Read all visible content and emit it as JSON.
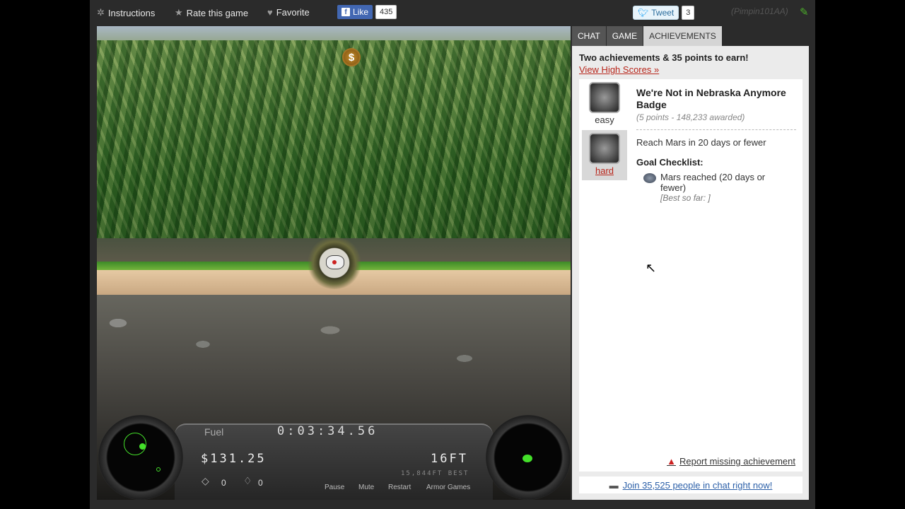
{
  "topbar": {
    "instructions": "Instructions",
    "rate": "Rate this game",
    "favorite": "Favorite",
    "fb_like": "Like",
    "fb_count": "435",
    "tweet": "Tweet",
    "tweet_count": "3",
    "username": "(Pimpin101AA)"
  },
  "game": {
    "coin_symbol": "$",
    "hud": {
      "fuel_label": "Fuel",
      "timer": "0:03:34.56",
      "money": "$131.25",
      "depth": "16FT",
      "best": "15,844FT BEST",
      "item1_count": "0",
      "item2_count": "0",
      "pause": "Pause",
      "mute": "Mute",
      "restart": "Restart",
      "armor": "Armor Games"
    },
    "radar_color": "#44e02a"
  },
  "panel": {
    "tabs": [
      "CHAT",
      "GAME",
      "ACHIEVEMENTS"
    ],
    "active_tab": "ACHIEVEMENTS",
    "headline": "Two achievements & 35 points to earn!",
    "high_scores_link": "View High Scores »",
    "difficulty": {
      "easy": "easy",
      "hard": "hard"
    },
    "achievement": {
      "title": "We're Not in Nebraska Anymore Badge",
      "meta": "(5 points - 148,233 awarded)",
      "description": "Reach Mars in 20 days or fewer",
      "goal_heading": "Goal Checklist:",
      "goal_item": "Mars reached (20 days or fewer)",
      "best_so_far": "[Best so far: ]"
    },
    "report_link": "Report missing achievement",
    "chat_link": "Join 35,525 people in chat right now!"
  }
}
